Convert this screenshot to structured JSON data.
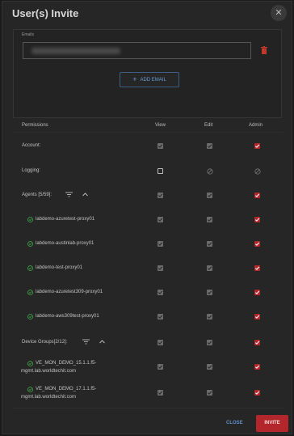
{
  "dialog": {
    "title": "User(s) Invite",
    "close_icon": "close-icon"
  },
  "emails": {
    "legend": "Emails",
    "value": "",
    "add_label": "ADD EMAIL"
  },
  "permissions": {
    "headers": {
      "name": "Permissions",
      "view": "View",
      "edit": "Edit",
      "admin": "Admin"
    },
    "account": {
      "label": "Account:"
    },
    "logging": {
      "label": "Logging:"
    },
    "agents": {
      "label": "Agents [5/59]:",
      "items": [
        "labdemo-azuretest-proxy01",
        "labdemo-austinlab-proxy01",
        "labdemo-test-proxy01",
        "labdemo-azuretest309-proxy01",
        "labdemo-aws309test-proxy01"
      ]
    },
    "device_groups": {
      "label": "Device Groups[2/12]:",
      "items": [
        {
          "line1": "VE_MON_DEMO_15.1.1.f5-",
          "line2": "mgmt.lab.worldtechit.com"
        },
        {
          "line1": "VE_MON_DEMO_17.1.1.f5-",
          "line2": "mgmt.lab.worldtechit.com"
        }
      ]
    }
  },
  "footer": {
    "close_label": "CLOSE",
    "invite_label": "INVITE"
  },
  "colors": {
    "accent_red": "#b3262b",
    "accent_blue": "#5f8fc7",
    "ok_green": "#3fae4a"
  }
}
